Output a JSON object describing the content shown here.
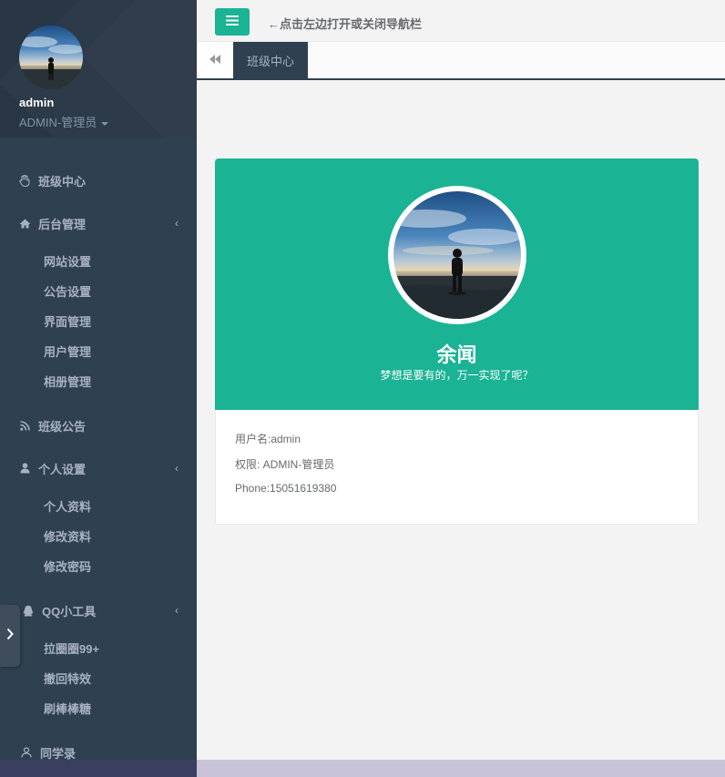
{
  "profile": {
    "name": "admin",
    "role": "ADMIN-管理员"
  },
  "topbar": {
    "hint": "←点击左边打开或关闭导航栏"
  },
  "tabs": {
    "active": "班级中心"
  },
  "sidebar": {
    "items": [
      {
        "label": "班级中心",
        "icon": "hand-icon"
      },
      {
        "label": "后台管理",
        "icon": "home-icon",
        "sub": [
          "网站设置",
          "公告设置",
          "界面管理",
          "用户管理",
          "相册管理"
        ]
      },
      {
        "label": "班级公告",
        "icon": "rss-icon"
      },
      {
        "label": "个人设置",
        "icon": "user-icon",
        "sub": [
          "个人资料",
          "修改资料",
          "修改密码"
        ]
      },
      {
        "label": "QQ小工具",
        "icon": "qq-icon",
        "sub": [
          "拉圈圈99+",
          "撤回特效",
          "刷棒棒糖"
        ]
      },
      {
        "label": "同学录",
        "icon": "group-icon"
      }
    ]
  },
  "card": {
    "name": "余闻",
    "motto": "梦想是要有的，万一实现了呢？",
    "username": "用户名:admin",
    "permission": "权限: ADMIN-管理员",
    "phone": "Phone:15051619380"
  },
  "colors": {
    "sidebar": "#2f4050",
    "accent": "#1ab394",
    "background": "#f3f3f4"
  }
}
